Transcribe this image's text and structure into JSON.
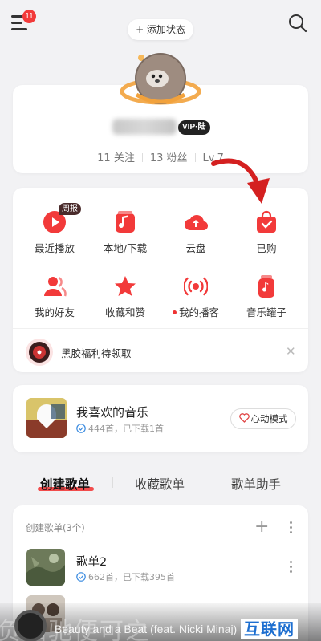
{
  "header": {
    "menu_badge": "11",
    "status_label": "+ 添加状态"
  },
  "profile": {
    "vip_label": "VIP·陆",
    "follow": "11 关注",
    "fans": "13 粉丝",
    "level": "Lv.7"
  },
  "grid": [
    {
      "label": "最近播放",
      "icon": "play-icon",
      "tag": "周报"
    },
    {
      "label": "本地/下载",
      "icon": "music-folder-icon"
    },
    {
      "label": "云盘",
      "icon": "cloud-upload-icon"
    },
    {
      "label": "已购",
      "icon": "purchased-bag-icon"
    },
    {
      "label": "我的好友",
      "icon": "friends-icon"
    },
    {
      "label": "收藏和赞",
      "icon": "star-icon"
    },
    {
      "label": "我的播客",
      "icon": "radio-icon"
    },
    {
      "label": "音乐罐子",
      "icon": "music-jar-icon"
    }
  ],
  "promo": {
    "text": "黑胶福利待领取"
  },
  "favorites": {
    "title": "我喜欢的音乐",
    "subtitle": "444首，已下载1首",
    "mode_button": "心动模式"
  },
  "tabs": [
    "创建歌单",
    "收藏歌单",
    "歌单助手"
  ],
  "playlists": {
    "header": "创建歌单(3个)",
    "items": [
      {
        "title": "歌单2",
        "subtitle": "662首，已下载395首"
      }
    ]
  },
  "player": {
    "overlay_text": "负归驰便可之",
    "track": "Beauty and a Beat (feat. Nicki Minaj)",
    "watermark": "互联网"
  },
  "colors": {
    "accent": "#f23a3a",
    "background": "#f2f2f4"
  }
}
